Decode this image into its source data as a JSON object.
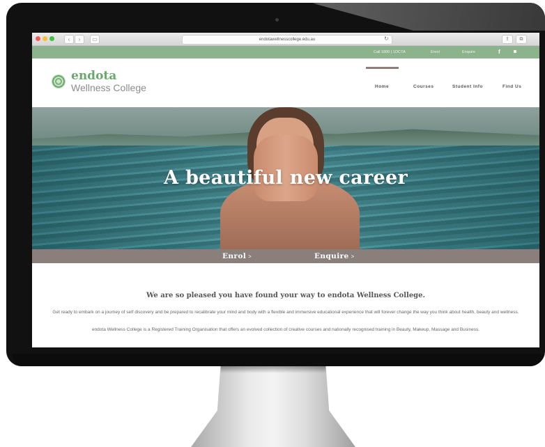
{
  "browser": {
    "url": "endotawellnesscollege.edu.au",
    "back_glyph": "‹",
    "forward_glyph": "›",
    "sidebar_glyph": "▭",
    "reload_glyph": "↻",
    "share_glyph": "⇪",
    "tabs_glyph": "⧉"
  },
  "topbar": {
    "call_label": "Call 1800 | 1OC7A",
    "enrol_label": "Enrol",
    "enquire_label": "Enquire",
    "facebook_glyph": "f",
    "instagram_glyph": "◙"
  },
  "header": {
    "brand_name": "endota",
    "brand_sub": "Wellness College",
    "nav": [
      {
        "label": "Home"
      },
      {
        "label": "Courses"
      },
      {
        "label": "Student Info"
      },
      {
        "label": "Find Us"
      }
    ]
  },
  "hero": {
    "title": "A beautiful new career"
  },
  "cta": {
    "enrol_label": "Enrol",
    "enquire_label": "Enquire",
    "chevron": ">"
  },
  "intro": {
    "heading": "We are so pleased you have found your way to endota Wellness College.",
    "paragraph1": "Get ready to embark on a journey of self discovery and be prepared to recalibrate your mind and body with a flexible and immersive educational experience that will forever change the way you think about health, beauty and wellness.",
    "paragraph2": "endota Wellness College is a Registered Training Organisation that offers an evolved collection of creative courses and nationally recognised training in Beauty, Makeup, Massage and Business."
  },
  "colors": {
    "brand_green": "#6aa86c",
    "topbar_green": "#8db38d",
    "cta_taupe": "#8a7f7a"
  }
}
